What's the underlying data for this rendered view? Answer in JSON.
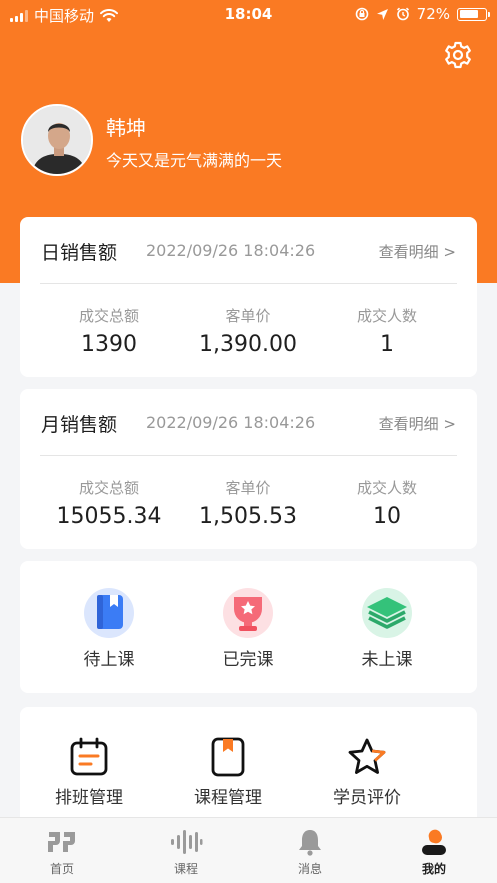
{
  "status_bar": {
    "carrier": "中国移动",
    "time": "18:04",
    "battery": "72%",
    "battery_level": 0.72
  },
  "profile": {
    "name": "韩坤",
    "motto": "今天又是元气满满的一天"
  },
  "daily_sales": {
    "title": "日销售额",
    "date": "2022/09/26 18:04:26",
    "link": "查看明细 >",
    "stats": [
      {
        "label": "成交总额",
        "value": "1390"
      },
      {
        "label": "客单价",
        "value": "1,390.00"
      },
      {
        "label": "成交人数",
        "value": "1"
      }
    ]
  },
  "monthly_sales": {
    "title": "月销售额",
    "date": "2022/09/26 18:04:26",
    "link": "查看明细 >",
    "stats": [
      {
        "label": "成交总额",
        "value": "15055.34"
      },
      {
        "label": "客单价",
        "value": "1,505.53"
      },
      {
        "label": "成交人数",
        "value": "10"
      }
    ]
  },
  "course_status": [
    {
      "label": "待上课",
      "icon": "book-icon"
    },
    {
      "label": "已完课",
      "icon": "trophy-icon"
    },
    {
      "label": "未上课",
      "icon": "layers-icon"
    }
  ],
  "management": [
    {
      "label": "排班管理",
      "icon": "calendar-icon"
    },
    {
      "label": "课程管理",
      "icon": "bookmark-icon"
    },
    {
      "label": "学员评价",
      "icon": "star-icon"
    }
  ],
  "tabs": [
    {
      "label": "首页",
      "icon": "home-logo-icon"
    },
    {
      "label": "课程",
      "icon": "waveform-icon"
    },
    {
      "label": "消息",
      "icon": "bell-icon"
    },
    {
      "label": "我的",
      "icon": "person-icon",
      "active": true
    }
  ],
  "colors": {
    "accent": "#fa7a23",
    "background": "#f4f5f7",
    "blue": "#3b7cf5",
    "pink": "#f56a78",
    "green": "#34c27a"
  }
}
